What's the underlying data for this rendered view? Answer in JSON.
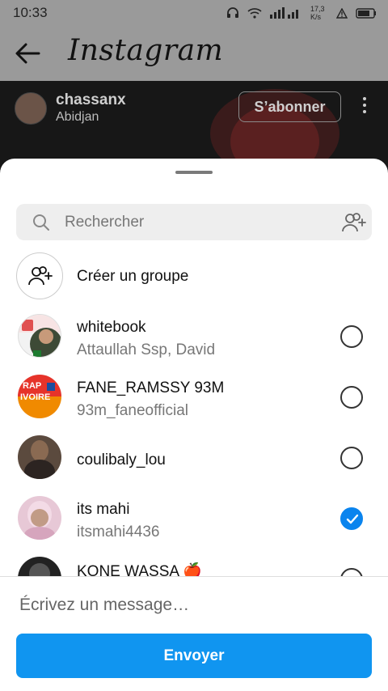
{
  "status": {
    "time": "10:33",
    "speed": "17,3 K/s"
  },
  "app": {
    "title": "Instagram"
  },
  "post": {
    "username": "chassanx",
    "location": "Abidjan",
    "subscribe_label": "S’abonner"
  },
  "search": {
    "placeholder": "Rechercher"
  },
  "group": {
    "label": "Créer un groupe"
  },
  "contacts": [
    {
      "name": "whitebook",
      "subtitle": "Attaullah Ssp, David",
      "selected": false
    },
    {
      "name": "FANE_RAMSSY 93M",
      "subtitle": "93m_faneofficial",
      "selected": false
    },
    {
      "name": "coulibaly_lou",
      "subtitle": "",
      "selected": false
    },
    {
      "name": "its mahi",
      "subtitle": "itsmahi4436",
      "selected": true
    },
    {
      "name": "KONE WASSA 🍎",
      "subtitle": "",
      "selected": false
    }
  ],
  "avatar_text": {
    "rap": "RAP",
    "ivoire": "IVOIRE"
  },
  "composer": {
    "placeholder": "Écrivez un message…",
    "send_label": "Envoyer"
  },
  "colors": {
    "accent": "#1095f0",
    "check": "#0a84ee"
  }
}
